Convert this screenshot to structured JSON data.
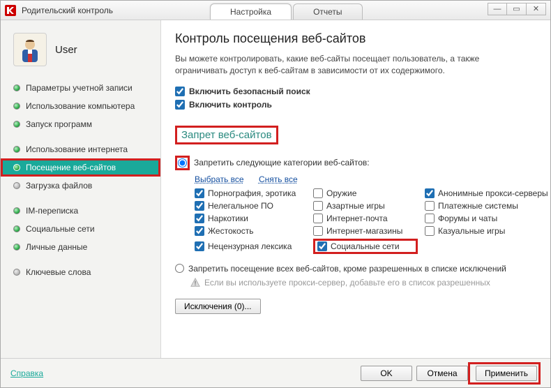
{
  "window": {
    "title": "Родительский контроль"
  },
  "win_controls": {
    "min": "—",
    "max": "▭",
    "close": "✕"
  },
  "tabs": {
    "settings": "Настройка",
    "reports": "Отчеты"
  },
  "user": {
    "name": "User"
  },
  "sidebar": {
    "items": [
      {
        "label": "Параметры учетной записи",
        "on": true
      },
      {
        "label": "Использование компьютера",
        "on": true
      },
      {
        "label": "Запуск программ",
        "on": true
      },
      {
        "label": "Использование интернета",
        "on": true
      },
      {
        "label": "Посещение веб-сайтов",
        "on": true
      },
      {
        "label": "Загрузка файлов",
        "on": false
      },
      {
        "label": "IM-переписка",
        "on": true
      },
      {
        "label": "Социальные сети",
        "on": true
      },
      {
        "label": "Личные данные",
        "on": true
      },
      {
        "label": "Ключевые слова",
        "on": false
      }
    ]
  },
  "page": {
    "title": "Контроль посещения веб-сайтов",
    "description": "Вы можете контролировать, какие веб-сайты посещает пользователь, а также ограничивать доступ к веб-сайтам в зависимости от их содержимого.",
    "safe_search": "Включить безопасный поиск",
    "enable_control": "Включить контроль",
    "section_block": "Запрет веб-сайтов",
    "radio_cats": "Запретить следующие категории веб-сайтов:",
    "select_all": "Выбрать все",
    "deselect_all": "Снять все",
    "categories": {
      "porn": "Порнография, эротика",
      "illegal_soft": "Нелегальное ПО",
      "drugs": "Наркотики",
      "violence": "Жестокость",
      "profanity": "Нецензурная лексика",
      "weapons": "Оружие",
      "gambling": "Азартные игры",
      "webmail": "Интернет-почта",
      "shops": "Интернет-магазины",
      "social": "Социальные сети",
      "anon_proxy": "Анонимные прокси-серверы",
      "payments": "Платежные системы",
      "forums": "Форумы и чаты",
      "casual": "Казуальные игры"
    },
    "radio_block_all": "Запретить посещение всех веб-сайтов, кроме разрешенных в списке исключений",
    "proxy_note": "Если вы используете прокси-сервер, добавьте его в список разрешенных",
    "exclusions_btn": "Исключения (0)..."
  },
  "footer": {
    "help": "Справка",
    "ok": "OK",
    "cancel": "Отмена",
    "apply": "Применить"
  }
}
